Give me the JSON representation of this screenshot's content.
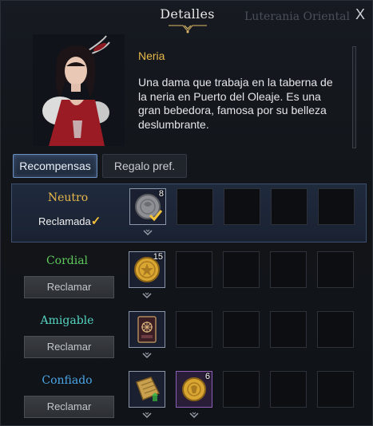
{
  "header": {
    "title": "Detalles",
    "background_map_label": "Luterania Oriental",
    "close_glyph": "X"
  },
  "npc": {
    "name": "Neria",
    "description": "Una dama que trabaja en la taberna de la neria en Puerto del Oleaje. Es una gran bebedora, famosa por su belleza deslumbrante."
  },
  "tabs": [
    {
      "label": "Recompensas",
      "selected": true
    },
    {
      "label": "Regalo pref.",
      "selected": false
    }
  ],
  "tiers": [
    {
      "name": "Neutro",
      "color": "#e8b94a",
      "status": "claimed",
      "claimed_label": "Reclamada",
      "rewards": [
        {
          "icon": "silver-coin-icon",
          "qty": "8",
          "claimed": true
        }
      ]
    },
    {
      "name": "Cordial",
      "color": "#5fc85a",
      "status": "claimable",
      "button_label": "Reclamar",
      "rewards": [
        {
          "icon": "gold-coin-icon",
          "qty": "15"
        }
      ]
    },
    {
      "name": "Amigable",
      "color": "#55d6c2",
      "status": "claimable",
      "button_label": "Reclamar",
      "rewards": [
        {
          "icon": "card-icon",
          "qty": ""
        }
      ]
    },
    {
      "name": "Confiado",
      "color": "#4aa6e8",
      "status": "claimable",
      "button_label": "Reclamar",
      "rewards": [
        {
          "icon": "map-scroll-icon",
          "qty": ""
        },
        {
          "icon": "gold-medal-icon",
          "qty": "6"
        }
      ]
    }
  ],
  "colors": {
    "accent_gold": "#e8b94a",
    "tab_selected_border": "#6d8fbf",
    "row_active_bg": "#1f2a3d"
  }
}
